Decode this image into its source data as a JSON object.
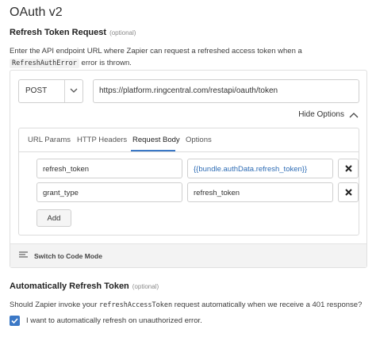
{
  "page": {
    "title": "OAuth v2"
  },
  "refresh_section": {
    "heading": "Refresh Token Request",
    "optional": "(optional)",
    "desc_before": "Enter the API endpoint URL where Zapier can request a refreshed access token when a ",
    "desc_code": "RefreshAuthError",
    "desc_after": " error is thrown."
  },
  "request": {
    "method": "POST",
    "url": "https://platform.ringcentral.com/restapi/oauth/token",
    "hide_options": "Hide Options"
  },
  "tabs": [
    {
      "label": "URL Params"
    },
    {
      "label": "HTTP Headers"
    },
    {
      "label": "Request Body"
    },
    {
      "label": "Options"
    }
  ],
  "active_tab": "Request Body",
  "body_rows": [
    {
      "key": "refresh_token",
      "value": "{{bundle.authData.refresh_token}}"
    },
    {
      "key": "grant_type",
      "value": "refresh_token"
    }
  ],
  "add_button": "Add",
  "code_mode": "Switch to Code Mode",
  "auto_section": {
    "heading": "Automatically Refresh Token",
    "optional": "(optional)",
    "question_before": "Should Zapier invoke your ",
    "question_code": "refreshAccessToken",
    "question_after": " request automatically when we receive a 401 response?",
    "checkbox_label": "I want to automatically refresh on unauthorized error.",
    "checked": true
  },
  "colors": {
    "accent": "#3b78c6",
    "template_text": "#2f6db5"
  }
}
